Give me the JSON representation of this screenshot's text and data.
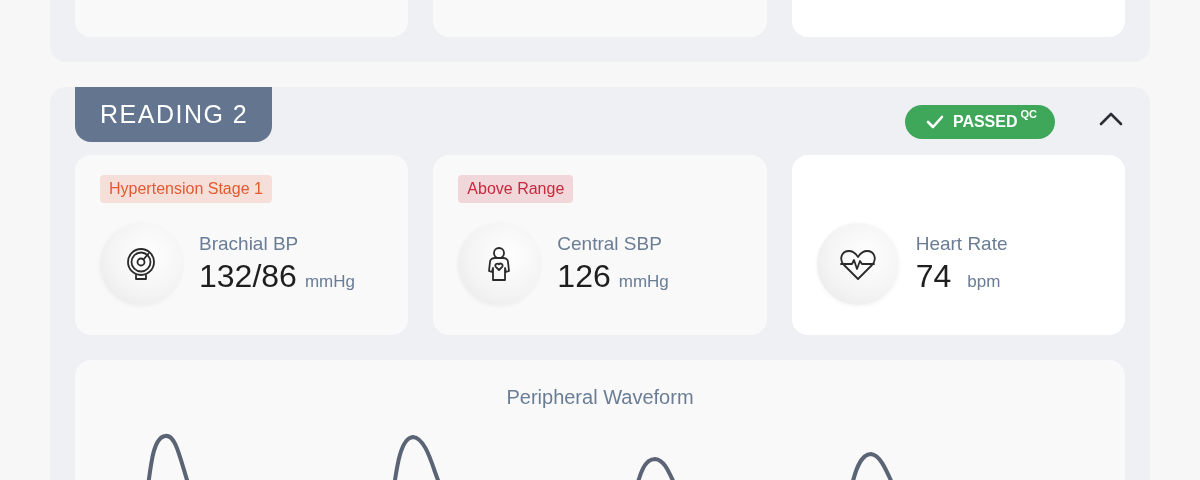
{
  "reading": {
    "title": "READING 2",
    "qc": {
      "label": "PASSED$^{QC}$",
      "passed": true
    },
    "expanded": true,
    "metrics": [
      {
        "kind": "gauge",
        "flag": {
          "text": "Hypertension Stage 1",
          "color": "#e35a2e"
        },
        "label": "Brachial BP",
        "value": "132/86",
        "unit": "mmHg"
      },
      {
        "kind": "person",
        "flag": {
          "text": "Above Range",
          "color": "#c8283c"
        },
        "label": "Central SBP",
        "value": "126",
        "unit": "mmHg"
      },
      {
        "kind": "heart",
        "label": "Heart Rate",
        "value": "74",
        "unit": "bpm"
      }
    ],
    "waveform": {
      "title": "Peripheral Waveform"
    }
  }
}
